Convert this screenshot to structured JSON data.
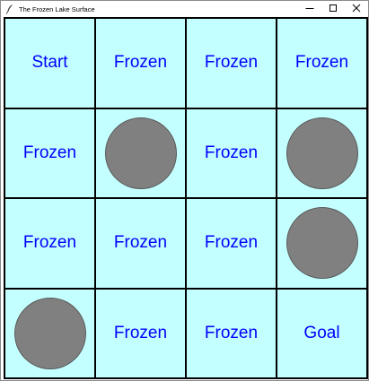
{
  "window": {
    "title": "The Frozen Lake Surface",
    "app_icon": "feather-icon",
    "controls": [
      "minimize-icon",
      "maximize-icon",
      "close-icon"
    ]
  },
  "colors": {
    "ice": "#c4ffff",
    "grid_line": "#000000",
    "label_text": "#0000ff",
    "hole": "#808080"
  },
  "board": {
    "rows": 4,
    "cols": 4,
    "cells": [
      {
        "type": "label",
        "text": "Start"
      },
      {
        "type": "label",
        "text": "Frozen"
      },
      {
        "type": "label",
        "text": "Frozen"
      },
      {
        "type": "label",
        "text": "Frozen"
      },
      {
        "type": "label",
        "text": "Frozen"
      },
      {
        "type": "hole",
        "text": ""
      },
      {
        "type": "label",
        "text": "Frozen"
      },
      {
        "type": "hole",
        "text": ""
      },
      {
        "type": "label",
        "text": "Frozen"
      },
      {
        "type": "label",
        "text": "Frozen"
      },
      {
        "type": "label",
        "text": "Frozen"
      },
      {
        "type": "hole",
        "text": ""
      },
      {
        "type": "hole",
        "text": ""
      },
      {
        "type": "label",
        "text": "Frozen"
      },
      {
        "type": "label",
        "text": "Frozen"
      },
      {
        "type": "label",
        "text": "Goal"
      }
    ]
  }
}
